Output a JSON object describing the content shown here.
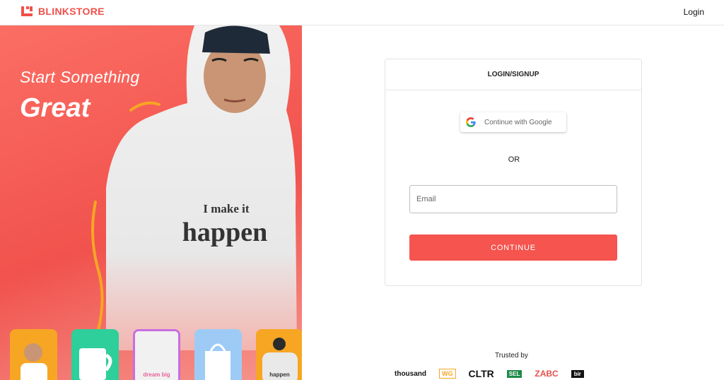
{
  "header": {
    "brand": "BLINKSTORE",
    "login_link": "Login",
    "accent_color": "#f0514b"
  },
  "hero": {
    "line1": "Start Something",
    "line2": "Great",
    "hoodie_text_1": "I make it",
    "hoodie_text_2": "happen",
    "thumbnails": [
      {
        "icon": "person-photo",
        "text": "",
        "border": "#f6a623"
      },
      {
        "icon": "mug-photo",
        "text": "",
        "border": "#2ecf9a"
      },
      {
        "icon": "tshirt-photo",
        "text": "dream big",
        "border": "#c86ee0"
      },
      {
        "icon": "tote-bag-photo",
        "text": "",
        "border": "#9ecbf5"
      },
      {
        "icon": "hoodie-back-photo",
        "text": "happen",
        "border": "#f6a623"
      }
    ]
  },
  "auth": {
    "title": "LOGIN/SIGNUP",
    "google_label": "Continue with Google",
    "or_text": "OR",
    "email_placeholder": "Email",
    "email_value": "",
    "continue_label": "CONTINUE",
    "button_color": "#f5544f"
  },
  "trusted": {
    "label": "Trusted by",
    "brands": [
      "thousand",
      "WG",
      "CLTR",
      "SEL",
      "ZABC",
      "bir"
    ]
  }
}
